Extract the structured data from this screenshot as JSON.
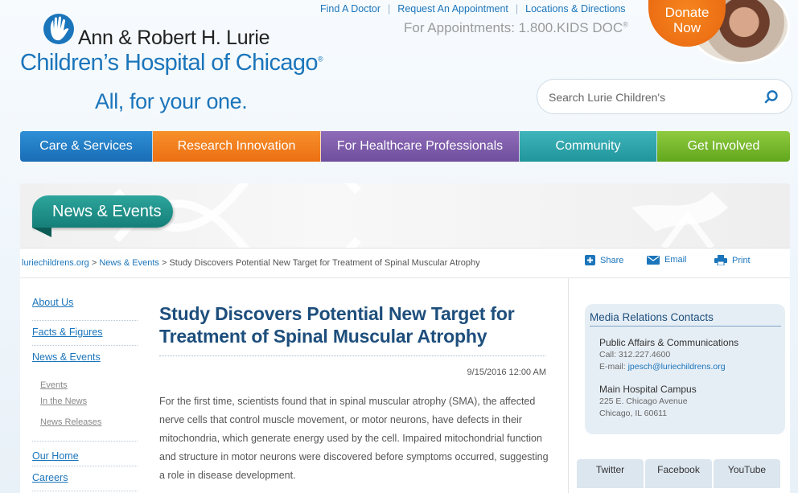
{
  "header": {
    "logo_line1": "Ann & Robert H. Lurie",
    "logo_line2": "Children’s Hospital of Chicago",
    "logo_registered": "®",
    "tagline": "All, for your one.",
    "top_links": [
      "Find A Doctor",
      "Request An Appointment",
      "Locations & Directions"
    ],
    "appointments": "For Appointments: 1.800.KIDS DOC",
    "appointments_reg": "®",
    "donate_line1": "Donate",
    "donate_line2": "Now",
    "search_placeholder": "Search Lurie Children's"
  },
  "nav": {
    "care": "Care & Services",
    "research": "Research Innovation",
    "health": "For Healthcare Professionals",
    "community": "Community",
    "involved": "Get Involved"
  },
  "banner": {
    "title": "News & Events"
  },
  "breadcrumb": {
    "home": "luriechildrens.org",
    "sep1": " > ",
    "section": "News & Events",
    "sep2": " > ",
    "current": "Study Discovers Potential New Target for Treatment of Spinal Muscular Atrophy"
  },
  "tools": {
    "share": "Share",
    "email": "Email",
    "print": "Print"
  },
  "left_nav": {
    "about": "About Us",
    "facts": "Facts & Figures",
    "news": "News & Events",
    "events": "Events",
    "in_the_news": "In the News",
    "releases": "News Releases",
    "home": "Our Home",
    "careers": "Careers"
  },
  "article": {
    "title": "Study Discovers Potential New Target for Treatment of Spinal Muscular Atrophy",
    "date": "9/15/2016 12:00 AM",
    "body": "For the first time, scientists found that in spinal muscular atrophy (SMA), the affected nerve cells that control muscle movement, or motor neurons, have defects in their mitochondria, which generate energy used by the cell. Impaired mitochondrial function and structure in motor neurons were discovered before symptoms occurred, suggesting a role in disease development."
  },
  "media": {
    "title": "Media Relations Contacts",
    "public_affairs": "Public Affairs & Communications",
    "call": "Call: 312.227.4600",
    "email_label": "E-mail: ",
    "email": "jpesch@luriechildrens.org",
    "campus": "Main Hospital Campus",
    "address1": "225 E. Chicago Avenue",
    "address2": "Chicago, IL 60611"
  },
  "social": {
    "twitter": "Twitter",
    "facebook": "Facebook",
    "youtube": "YouTube"
  },
  "colors": {
    "brand_blue": "#1b75bb",
    "care": "#1a6db5",
    "research": "#ec6f12",
    "health": "#6e4e9d",
    "community": "#21959c",
    "involved": "#62a71d",
    "news_tab": "#157f78",
    "donate": "#e8650f"
  },
  "icons": [
    "hand-logo-icon",
    "search-icon",
    "share-icon",
    "email-icon",
    "print-icon"
  ]
}
